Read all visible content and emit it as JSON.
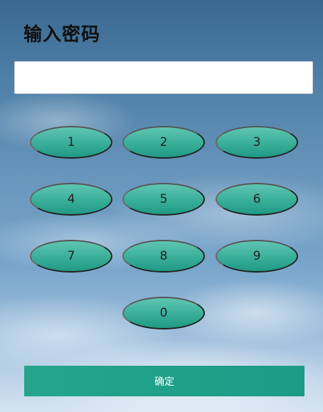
{
  "title": "输入密码",
  "password_input": {
    "value": "",
    "placeholder": ""
  },
  "keypad": {
    "keys": [
      "1",
      "2",
      "3",
      "4",
      "5",
      "6",
      "7",
      "8",
      "9",
      "0"
    ]
  },
  "confirm_label": "确定",
  "colors": {
    "key_fill": "#3cb09b",
    "confirm_fill": "#1fa08a",
    "input_background": "#ffffff"
  }
}
